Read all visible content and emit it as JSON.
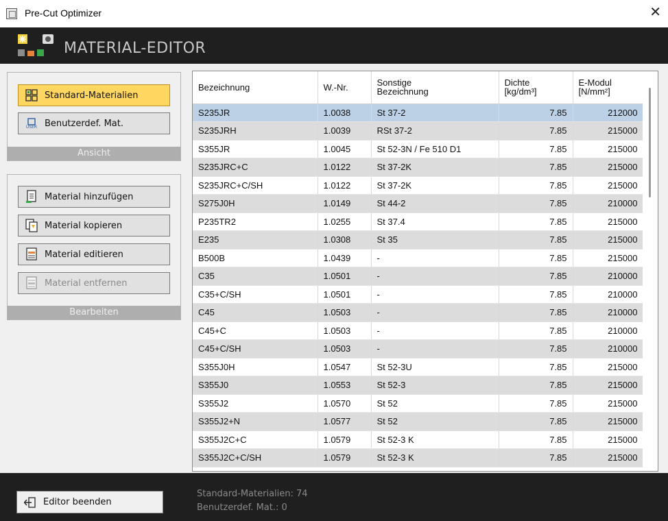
{
  "window": {
    "title": "Pre-Cut Optimizer",
    "close_glyph": "✕"
  },
  "header": {
    "title": "MATERIAL-EDITOR",
    "logo_icon": "material-editor-logo-icon"
  },
  "view_group": {
    "caption": "Ansicht",
    "buttons": [
      {
        "label": "Standard-Materialien",
        "icon": "grid-icon",
        "active": true
      },
      {
        "label": "Benutzerdef. Mat.",
        "icon": "user-icon",
        "icon_text": "USER",
        "active": false
      }
    ]
  },
  "edit_group": {
    "caption": "Bearbeiten",
    "buttons": [
      {
        "label": "Material hinzufügen",
        "icon": "add-document-icon",
        "enabled": true
      },
      {
        "label": "Material kopieren",
        "icon": "copy-document-icon",
        "enabled": true
      },
      {
        "label": "Material editieren",
        "icon": "edit-document-icon",
        "enabled": true
      },
      {
        "label": "Material entfernen",
        "icon": "remove-document-icon",
        "enabled": false
      }
    ]
  },
  "table": {
    "columns": [
      {
        "line1": "Bezeichnung",
        "line2": ""
      },
      {
        "line1": "W.-Nr.",
        "line2": ""
      },
      {
        "line1": "Sonstige",
        "line2": "Bezeichnung"
      },
      {
        "line1": "Dichte",
        "line2": "[kg/dm³]"
      },
      {
        "line1": "E-Modul",
        "line2": "[N/mm²]"
      }
    ],
    "selected_row": 0,
    "rows": [
      [
        "S235JR",
        "1.0038",
        "St 37-2",
        "7.85",
        "212000"
      ],
      [
        "S235JRH",
        "1.0039",
        "RSt 37-2",
        "7.85",
        "215000"
      ],
      [
        "S355JR",
        "1.0045",
        "St 52-3N / Fe 510 D1",
        "7.85",
        "215000"
      ],
      [
        "S235JRC+C",
        "1.0122",
        "St 37-2K",
        "7.85",
        "215000"
      ],
      [
        "S235JRC+C/SH",
        "1.0122",
        "St 37-2K",
        "7.85",
        "215000"
      ],
      [
        "S275J0H",
        "1.0149",
        "St 44-2",
        "7.85",
        "210000"
      ],
      [
        "P235TR2",
        "1.0255",
        "St 37.4",
        "7.85",
        "215000"
      ],
      [
        "E235",
        "1.0308",
        "St 35",
        "7.85",
        "215000"
      ],
      [
        "B500B",
        "1.0439",
        "-",
        "7.85",
        "215000"
      ],
      [
        "C35",
        "1.0501",
        "-",
        "7.85",
        "210000"
      ],
      [
        "C35+C/SH",
        "1.0501",
        "-",
        "7.85",
        "210000"
      ],
      [
        "C45",
        "1.0503",
        "-",
        "7.85",
        "210000"
      ],
      [
        "C45+C",
        "1.0503",
        "-",
        "7.85",
        "210000"
      ],
      [
        "C45+C/SH",
        "1.0503",
        "-",
        "7.85",
        "210000"
      ],
      [
        "S355J0H",
        "1.0547",
        "St 52-3U",
        "7.85",
        "215000"
      ],
      [
        "S355J0",
        "1.0553",
        "St 52-3",
        "7.85",
        "215000"
      ],
      [
        "S355J2",
        "1.0570",
        "St 52",
        "7.85",
        "215000"
      ],
      [
        "S355J2+N",
        "1.0577",
        "St 52",
        "7.85",
        "215000"
      ],
      [
        "S355J2C+C",
        "1.0579",
        "St 52-3 K",
        "7.85",
        "215000"
      ],
      [
        "S355J2C+C/SH",
        "1.0579",
        "St 52-3 K",
        "7.85",
        "215000"
      ]
    ]
  },
  "footer": {
    "exit_label": "Editor beenden",
    "exit_icon": "exit-icon",
    "status_standard": "Standard-Materialien: 74",
    "status_user": "Benutzerdef. Mat.: 0"
  },
  "colors": {
    "active_button": "#ffd760",
    "selected_row": "#bcd0e6",
    "header_bg": "#1f1f1f",
    "caption_bg": "#aeaeae"
  }
}
